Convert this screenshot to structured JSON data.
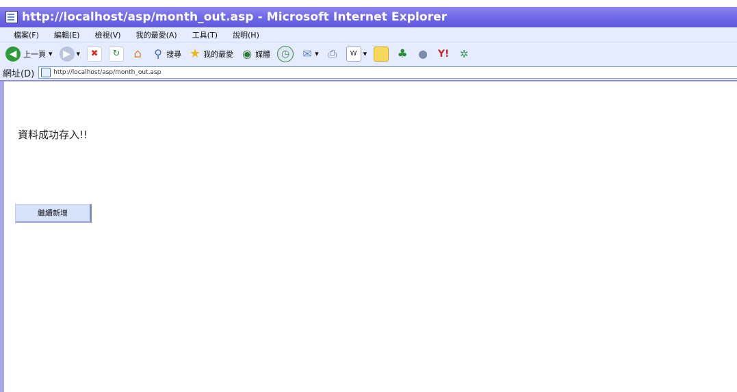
{
  "window": {
    "title": "http://localhost/asp/month_out.asp - Microsoft Internet Explorer"
  },
  "menubar": {
    "items": [
      "檔案(F)",
      "編輯(E)",
      "檢視(V)",
      "我的最愛(A)",
      "工具(T)",
      "說明(H)"
    ]
  },
  "toolbar": {
    "back_label": "上一頁",
    "search_label": "搜尋",
    "favorites_label": "我的最愛",
    "media_label": "媒體"
  },
  "address": {
    "label": "網址(D)",
    "url": "http://localhost/asp/month_out.asp"
  },
  "page": {
    "message": "資料成功存入!!",
    "continue_button": "繼續新增"
  },
  "colors": {
    "titlebar": "#6e67e6",
    "chrome": "#e6ecff",
    "button": "#d7e3fb"
  }
}
